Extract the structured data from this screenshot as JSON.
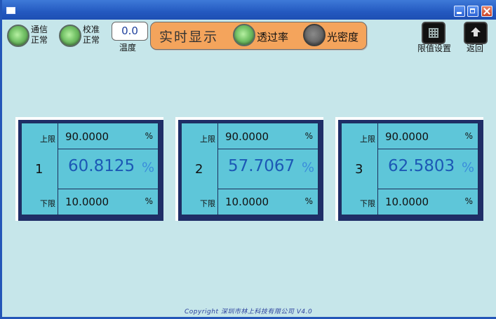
{
  "window": {
    "title": ""
  },
  "status": {
    "comm": {
      "line1": "通信",
      "line2": "正常"
    },
    "calib": {
      "line1": "校准",
      "line2": "正常"
    },
    "temp": {
      "value": "0.0",
      "label": "温度"
    }
  },
  "realtime": {
    "title": "实时显示",
    "transmittance_label": "透过率",
    "density_label": "光密度",
    "transmittance_active": true,
    "density_active": false
  },
  "toolbar": {
    "limit_label": "限值设置",
    "back_label": "返回"
  },
  "cards": [
    {
      "upper_label": "上限",
      "lower_label": "下限",
      "upper": "90.0000",
      "lower": "10.0000",
      "index": "1",
      "value": "60.8125",
      "unit": "%"
    },
    {
      "upper_label": "上限",
      "lower_label": "下限",
      "upper": "90.0000",
      "lower": "10.0000",
      "index": "2",
      "value": "57.7067",
      "unit": "%"
    },
    {
      "upper_label": "上限",
      "lower_label": "下限",
      "upper": "90.0000",
      "lower": "10.0000",
      "index": "3",
      "value": "62.5803",
      "unit": "%"
    }
  ],
  "footer": {
    "copyright": "Copyright 深圳市林上科技有限公司 V4.0"
  },
  "colors": {
    "background": "#c6e6ea",
    "card_fill": "#5ec6d9",
    "value_text": "#1c58b5",
    "panel": "#f4a45c",
    "titlebar": "#2459c0"
  }
}
